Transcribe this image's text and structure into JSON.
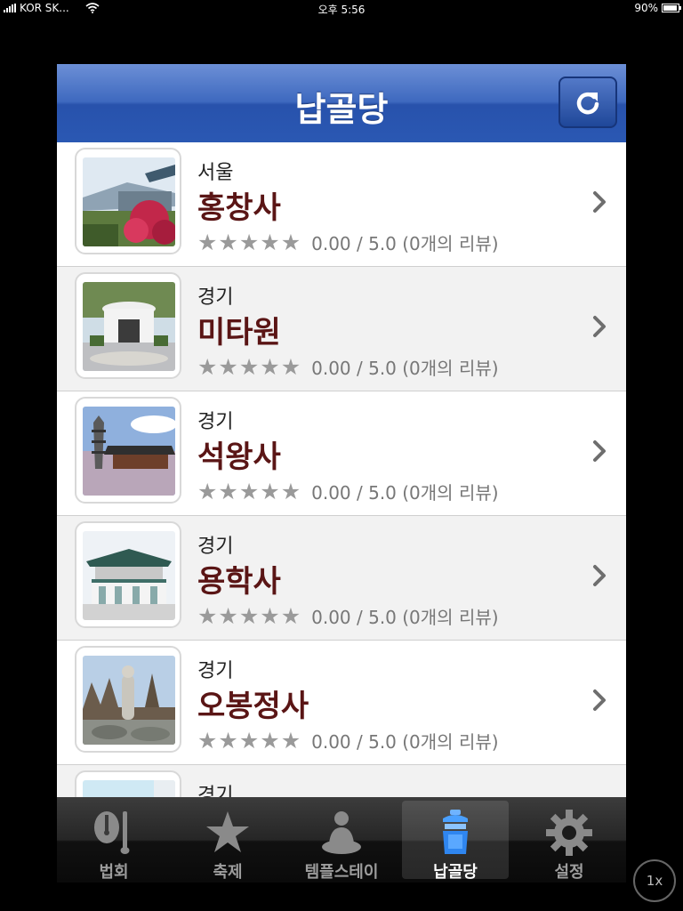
{
  "status_bar": {
    "carrier": "KOR SK...",
    "time": "오후 5:56",
    "battery": "90%"
  },
  "nav": {
    "title": "납골당",
    "refresh_icon": "refresh-icon"
  },
  "list": {
    "items": [
      {
        "region": "서울",
        "name": "홍창사",
        "rating": "0.00 / 5.0 (0개의 리뷰)"
      },
      {
        "region": "경기",
        "name": "미타원",
        "rating": "0.00 / 5.0 (0개의 리뷰)"
      },
      {
        "region": "경기",
        "name": "석왕사",
        "rating": "0.00 / 5.0 (0개의 리뷰)"
      },
      {
        "region": "경기",
        "name": "용학사",
        "rating": "0.00 / 5.0 (0개의 리뷰)"
      },
      {
        "region": "경기",
        "name": "오봉정사",
        "rating": "0.00 / 5.0 (0개의 리뷰)"
      },
      {
        "region": "경기"
      }
    ]
  },
  "tabs": [
    {
      "label": "법회",
      "icon": "moktak-icon"
    },
    {
      "label": "축제",
      "icon": "star-icon"
    },
    {
      "label": "템플스테이",
      "icon": "monk-icon"
    },
    {
      "label": "납골당",
      "icon": "urn-icon",
      "active": true
    },
    {
      "label": "설정",
      "icon": "gear-icon"
    }
  ],
  "zoom": "1x",
  "colors": {
    "nav": "#2a58b3",
    "name_text": "#5a1515",
    "tab_bar": "#1a1a1a"
  }
}
